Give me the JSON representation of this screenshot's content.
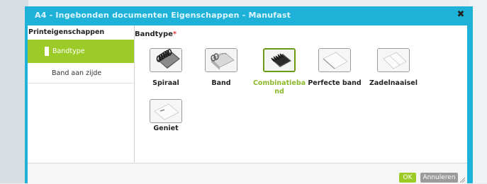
{
  "dialog": {
    "title": "A4 - Ingebonden documenten Eigenschappen - Manufast",
    "close_label": "✖"
  },
  "sidebar": {
    "title": "Printeigenschappen",
    "items": [
      {
        "label": "Bandtype",
        "active": true
      },
      {
        "label": "Band aan zijde",
        "active": false
      }
    ]
  },
  "main": {
    "section_title": "Bandtype",
    "required_marker": "*",
    "options": [
      {
        "label": "Spiraal",
        "icon": "spiral-binding-icon",
        "selected": false
      },
      {
        "label": "Band",
        "icon": "band-binding-icon",
        "selected": false
      },
      {
        "label": "Combinatieba\nnd",
        "icon": "combination-binding-icon",
        "selected": true
      },
      {
        "label": "Perfecte band",
        "icon": "perfect-binding-icon",
        "selected": false
      },
      {
        "label": "Zadelnaaisel",
        "icon": "saddle-stitch-icon",
        "selected": false
      },
      {
        "label": "Geniet",
        "icon": "staple-icon",
        "selected": false
      }
    ]
  },
  "footer": {
    "ok_label": "OK",
    "cancel_label": "Annuleren"
  },
  "colors": {
    "accent_cyan": "#1eb2d8",
    "accent_green": "#9ccb28",
    "required_red": "#e23c3c",
    "cancel_grey": "#9b9b9b"
  }
}
